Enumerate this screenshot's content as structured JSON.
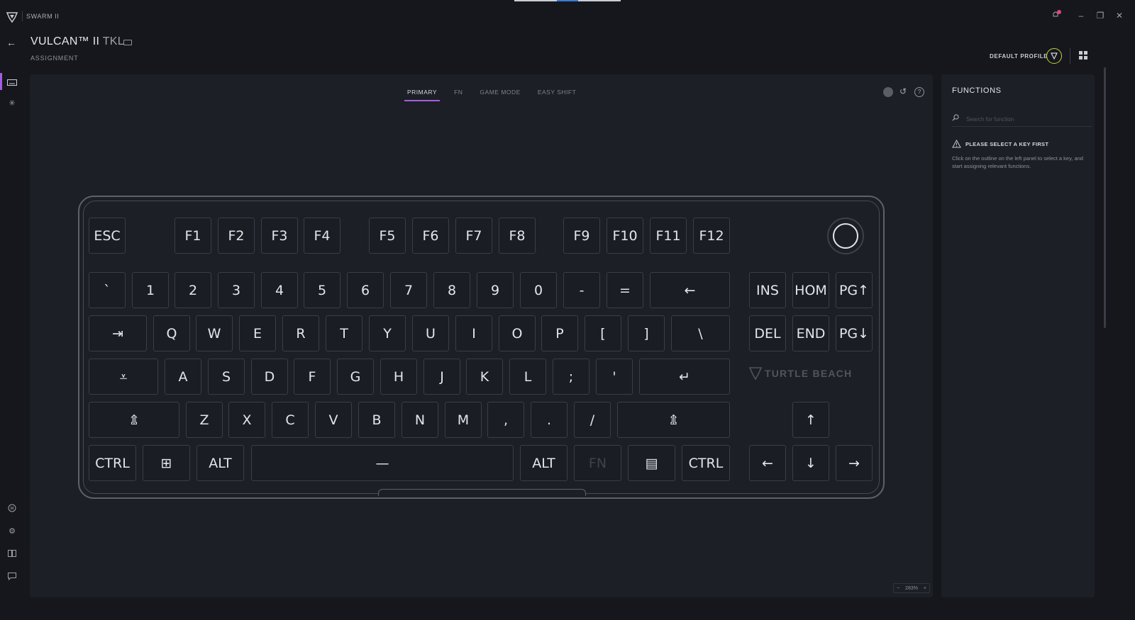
{
  "app": {
    "name": "SWARM II"
  },
  "window": {
    "notifications": "notification-bell-icon",
    "minimize": "–",
    "maximize": "❐",
    "close": "✕"
  },
  "header": {
    "back": "←",
    "device_name": "VULCAN™ II",
    "device_model": "TKL",
    "subtitle": "ASSIGNMENT",
    "profile_label": "DEFAULT PROFILE"
  },
  "tabs": [
    {
      "label": "PRIMARY",
      "active": true
    },
    {
      "label": "FN",
      "active": false
    },
    {
      "label": "GAME MODE",
      "active": false
    },
    {
      "label": "EASY SHIFT",
      "active": false
    }
  ],
  "tools": {
    "reset": "↺",
    "help": "?"
  },
  "keyboard": {
    "brand": "TURTLE BEACH",
    "keys": {
      "esc": "ESC",
      "f1": "F1",
      "f2": "F2",
      "f3": "F3",
      "f4": "F4",
      "f5": "F5",
      "f6": "F6",
      "f7": "F7",
      "f8": "F8",
      "f9": "F9",
      "f10": "F10",
      "f11": "F11",
      "f12": "F12",
      "grave": "`",
      "n1": "1",
      "n2": "2",
      "n3": "3",
      "n4": "4",
      "n5": "5",
      "n6": "6",
      "n7": "7",
      "n8": "8",
      "n9": "9",
      "n0": "0",
      "minus": "-",
      "equal": "=",
      "backspace": "←",
      "ins": "INS",
      "home": "HOM",
      "pgup": "PG↑",
      "tab": "⇥",
      "q": "Q",
      "w": "W",
      "e": "E",
      "r": "R",
      "t": "T",
      "y": "Y",
      "u": "U",
      "i": "I",
      "o": "O",
      "p": "P",
      "lbracket": "[",
      "rbracket": "]",
      "backslash": "\\",
      "del": "DEL",
      "end": "END",
      "pgdn": "PG↓",
      "caps": "⩡",
      "a": "A",
      "s": "S",
      "d": "D",
      "f": "F",
      "g": "G",
      "h": "H",
      "j": "J",
      "k": "K",
      "l": "L",
      "semicolon": ";",
      "quote": "'",
      "enter": "↵",
      "lshift": "⇭",
      "z": "Z",
      "x": "X",
      "c": "C",
      "v": "V",
      "b": "B",
      "n": "N",
      "m": "M",
      "comma": ",",
      "period": ".",
      "slash": "/",
      "rshift": "⇭",
      "up": "↑",
      "lctrl": "CTRL",
      "win": "⊞",
      "lalt": "ALT",
      "space": "—",
      "ralt": "ALT",
      "fn": "FN",
      "menu": "▤",
      "rctrl": "CTRL",
      "left": "←",
      "down": "↓",
      "right": "→"
    }
  },
  "zoom": {
    "minus": "−",
    "value": "283%",
    "plus": "+"
  },
  "functions_panel": {
    "title": "FUNCTIONS",
    "search_placeholder": "Search for function",
    "warning_title": "PLEASE SELECT A KEY FIRST",
    "warning_body": "Click on the outline on the left panel to select a key, and start assigning relevant functions."
  },
  "colors": {
    "accent": "#a45de0",
    "profile_ring": "#c8d23a",
    "notification": "#e0457b"
  }
}
